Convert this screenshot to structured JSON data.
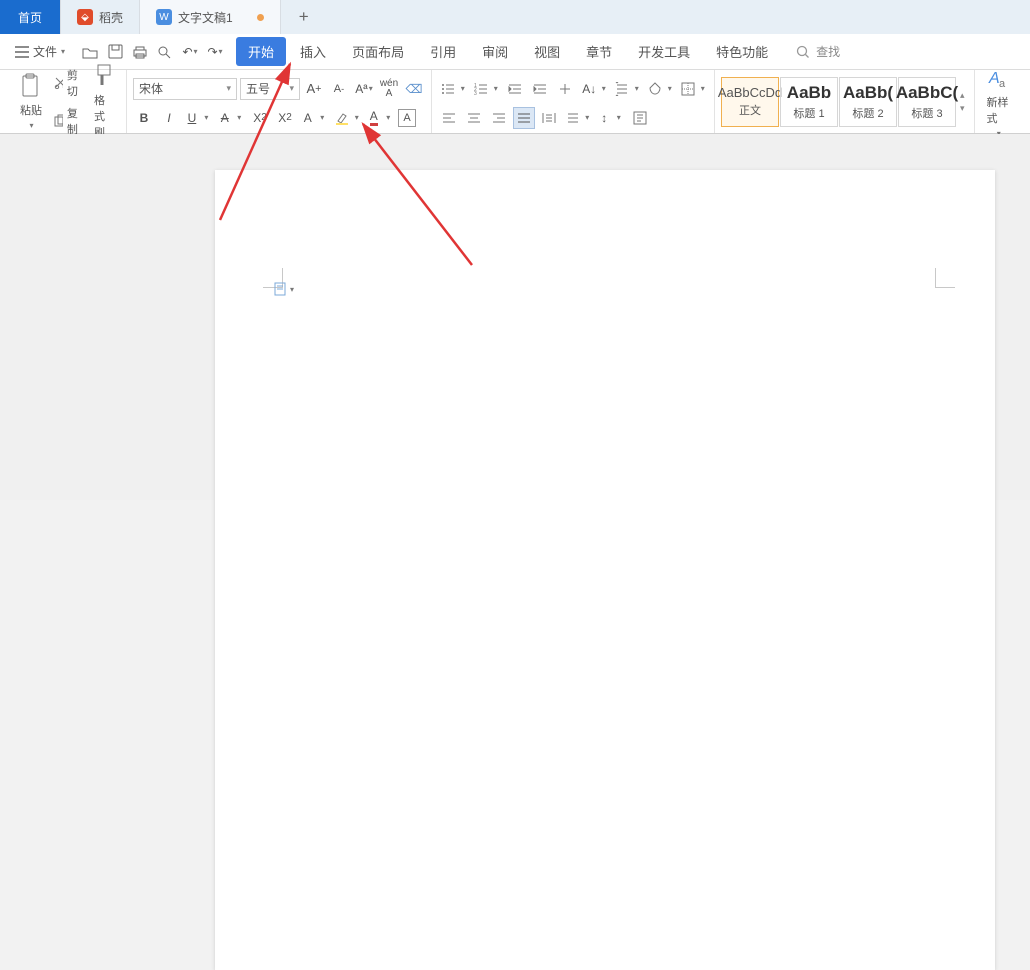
{
  "tabs": {
    "home": "首页",
    "docer": "稻壳",
    "doc": "文字文稿1",
    "plus": "+"
  },
  "menu": {
    "file": "文件",
    "items": [
      "开始",
      "插入",
      "页面布局",
      "引用",
      "审阅",
      "视图",
      "章节",
      "开发工具",
      "特色功能"
    ],
    "search": "查找"
  },
  "clipboard": {
    "paste": "粘贴",
    "cut": "剪切",
    "copy": "复制",
    "fmtpainter": "格式刷"
  },
  "font": {
    "name": "宋体",
    "size": "五号"
  },
  "styles": [
    {
      "preview": "AaBbCcDd",
      "label": "正文",
      "active": true,
      "big": false
    },
    {
      "preview": "AaBb",
      "label": "标题 1",
      "active": false,
      "big": true
    },
    {
      "preview": "AaBb(",
      "label": "标题 2",
      "active": false,
      "big": true
    },
    {
      "preview": "AaBbC(",
      "label": "标题 3",
      "active": false,
      "big": true
    }
  ],
  "newstyle": "新样式"
}
